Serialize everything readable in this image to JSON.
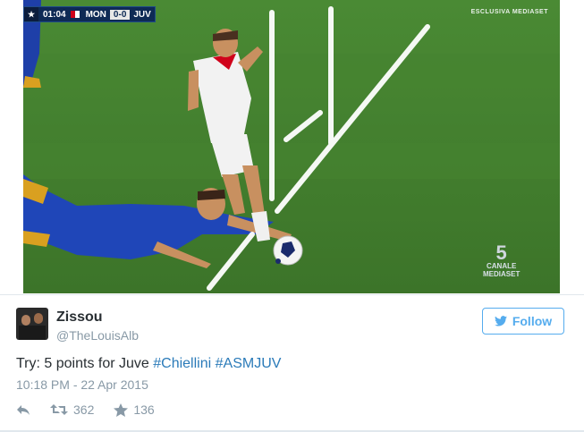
{
  "media": {
    "scorebug": {
      "time": "01:04",
      "home": "MON",
      "score": "0-0",
      "away": "JUV"
    },
    "broadcaster": "ESCLUSIVA MEDIASET",
    "channel_logo": {
      "number": "5",
      "text": "CANALE",
      "brand": "MEDIASET"
    }
  },
  "tweet": {
    "display_name": "Zissou",
    "handle": "@TheLouisAlb",
    "follow_label": "Follow",
    "text_prefix": "Try: 5 points for Juve ",
    "hashtags": [
      "#Chiellini",
      "#ASMJUV"
    ],
    "timestamp": "10:18 PM - 22 Apr 2015",
    "retweets": "362",
    "favorites": "136"
  },
  "colors": {
    "accent": "#55acee",
    "link": "#2b7bb9",
    "muted": "#8899a6",
    "text": "#292f33"
  }
}
